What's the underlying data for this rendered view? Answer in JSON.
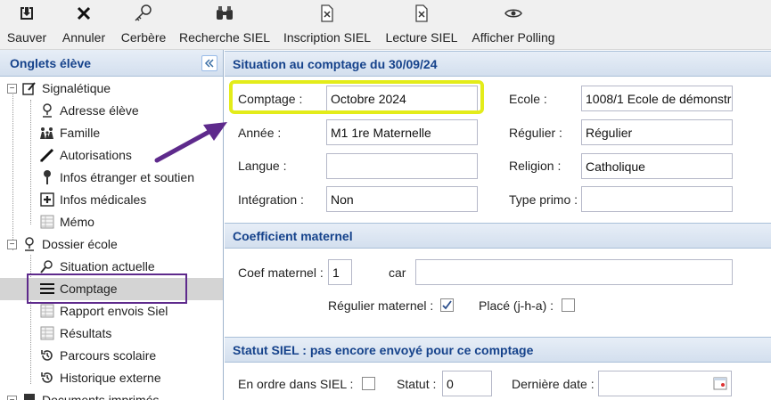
{
  "toolbar": {
    "save": "Sauver",
    "cancel": "Annuler",
    "cerbere": "Cerbère",
    "search": "Recherche SIEL",
    "inscription": "Inscription SIEL",
    "lecture": "Lecture SIEL",
    "polling": "Afficher Polling"
  },
  "sidebar": {
    "title": "Onglets élève",
    "items": [
      {
        "label": "Signalétique",
        "icon": "edit-doc-icon"
      },
      {
        "label": "Adresse élève",
        "icon": "location-pin-icon"
      },
      {
        "label": "Famille",
        "icon": "family-icon"
      },
      {
        "label": "Autorisations",
        "icon": "pen-icon"
      },
      {
        "label": "Infos étranger et soutien",
        "icon": "pin-icon"
      },
      {
        "label": "Infos médicales",
        "icon": "medical-icon"
      },
      {
        "label": "Mémo",
        "icon": "grid-icon"
      },
      {
        "label": "Dossier école",
        "icon": "location-pin-icon"
      },
      {
        "label": "Situation actuelle",
        "icon": "search-pin-icon"
      },
      {
        "label": "Comptage",
        "icon": "list-icon"
      },
      {
        "label": "Rapport envois Siel",
        "icon": "grid-icon"
      },
      {
        "label": "Résultats",
        "icon": "grid-icon"
      },
      {
        "label": "Parcours scolaire",
        "icon": "history-icon"
      },
      {
        "label": "Historique externe",
        "icon": "history-icon"
      },
      {
        "label": "Documents imprimés",
        "icon": "doc-icon"
      }
    ]
  },
  "situation": {
    "title": "Situation au comptage du 30/09/24",
    "comptage_label": "Comptage :",
    "comptage_value": "Octobre 2024",
    "ecole_label": "Ecole :",
    "ecole_value": "1008/1 Ecole de démonstr",
    "annee_label": "Année :",
    "annee_value": "M1 1re Maternelle",
    "regulier_label": "Régulier :",
    "regulier_value": "Régulier",
    "langue_label": "Langue :",
    "langue_value": "",
    "religion_label": "Religion :",
    "religion_value": "Catholique",
    "integration_label": "Intégration :",
    "integration_value": "Non",
    "type_primo_label": "Type primo :",
    "type_primo_value": ""
  },
  "coef": {
    "title": "Coefficient maternel",
    "coef_label": "Coef maternel :",
    "coef_value": "1",
    "car_label": "car",
    "car_value": "",
    "regulier_mat_label": "Régulier maternel :",
    "regulier_mat_checked": true,
    "place_label": "Placé (j-h-a) :",
    "place_checked": false
  },
  "statut": {
    "title": "Statut SIEL : pas encore envoyé pour ce comptage",
    "en_ordre_label": "En ordre dans SIEL :",
    "en_ordre_checked": false,
    "statut_label": "Statut :",
    "statut_value": "0",
    "derniere_label": "Dernière date :",
    "derniere_value": ""
  },
  "colors": {
    "accent": "#15428b",
    "highlight": "#e3ec1a",
    "annotation": "#5e2a8c"
  }
}
